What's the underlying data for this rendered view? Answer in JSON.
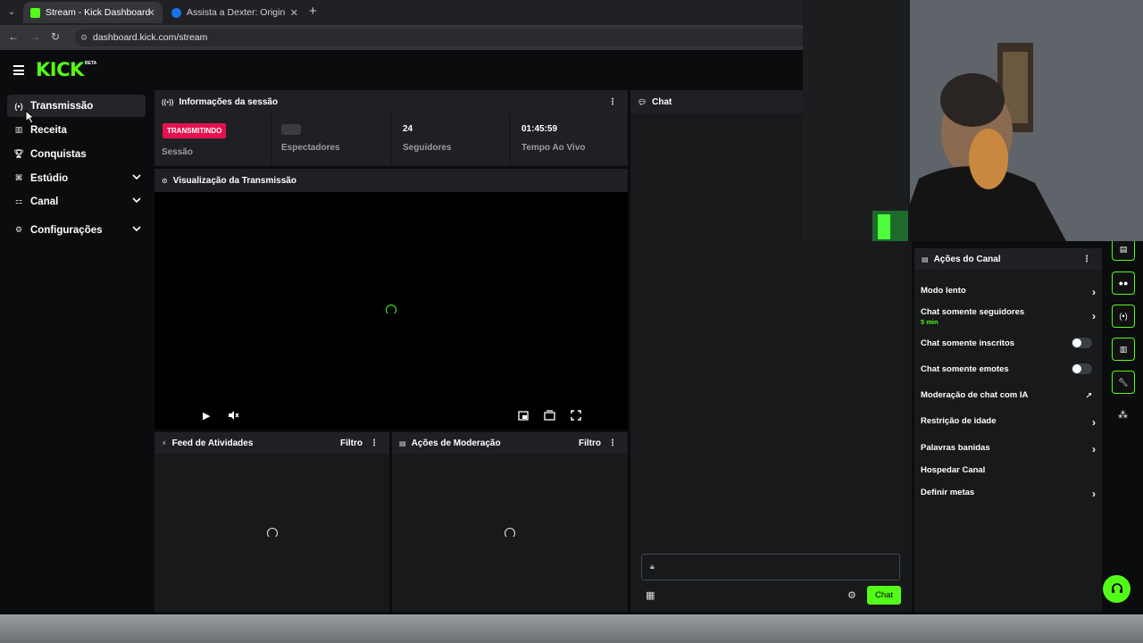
{
  "browser": {
    "tabs": [
      {
        "title": "Stream - Kick Dashboard",
        "favicon_color": "#53fc18",
        "active": true
      },
      {
        "title": "Assista a Dexter: Original Sin: D",
        "favicon_color": "#1a73e8",
        "active": false
      }
    ],
    "url": "dashboard.kick.com/stream"
  },
  "brand": {
    "logo": "KICK",
    "beta": "BETA",
    "accent": "#53fc18",
    "live_color": "#e4134f"
  },
  "sidebar": {
    "items": [
      {
        "label": "Transmissão",
        "icon": "broadcast-icon"
      },
      {
        "label": "Receita",
        "icon": "chart-icon"
      },
      {
        "label": "Conquistas",
        "icon": "trophy-icon"
      },
      {
        "label": "Estúdio",
        "icon": "studio-icon"
      },
      {
        "label": "Canal",
        "icon": "channel-icon"
      },
      {
        "label": "Configurações",
        "icon": "gear-icon"
      }
    ]
  },
  "session": {
    "title": "Informações da sessão",
    "live_badge": "TRANSMITINDO",
    "stats": [
      {
        "value": "",
        "label": "Sessão"
      },
      {
        "value": "",
        "label": "Espectadores"
      },
      {
        "value": "24",
        "label": "Seguidores"
      },
      {
        "value": "01:45:59",
        "label": "Tempo Ao Vivo"
      }
    ]
  },
  "preview": {
    "title": "Visualização da Transmissão"
  },
  "activity": {
    "title": "Feed de Atividades",
    "filter": "Filtro"
  },
  "moderation": {
    "title": "Ações de Moderação",
    "filter": "Filtro"
  },
  "chat": {
    "title": "Chat",
    "send_label": "Chat"
  },
  "channel_actions": {
    "title": "Ações do Canal",
    "items": [
      {
        "label": "Modo lento",
        "sub": "",
        "control": "arrow"
      },
      {
        "label": "Chat somente seguidores",
        "sub": "5 min",
        "control": "arrow"
      },
      {
        "label": "Chat somente inscritos",
        "sub": "",
        "control": "toggle",
        "on": false
      },
      {
        "label": "Chat somente emotes",
        "sub": "",
        "control": "toggle",
        "on": false
      },
      {
        "label": "Moderação de chat com IA",
        "sub": "",
        "control": "external"
      },
      {
        "label": "Restrição de idade",
        "sub": "",
        "control": "arrow"
      },
      {
        "label": "Palavras banidas",
        "sub": "",
        "control": "arrow"
      },
      {
        "label": "Hospedar Canal",
        "sub": "",
        "control": "none"
      },
      {
        "label": "Definir metas",
        "sub": "",
        "control": "arrow"
      }
    ]
  }
}
